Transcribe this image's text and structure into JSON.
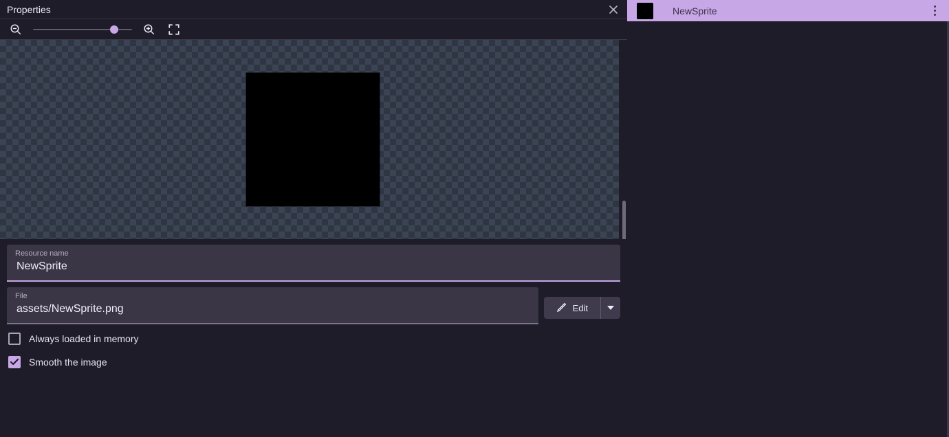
{
  "panel": {
    "title": "Properties"
  },
  "toolbar": {
    "zoom_out_icon": "zoom-out",
    "zoom_in_icon": "zoom-in",
    "fit_icon": "fit-screen",
    "slider_pct": 82
  },
  "preview": {
    "sprite_color": "#000000"
  },
  "fields": {
    "resource_label": "Resource name",
    "resource_value": "NewSprite",
    "file_label": "File",
    "file_value": "assets/NewSprite.png"
  },
  "edit": {
    "label": "Edit"
  },
  "checkboxes": {
    "always_loaded": {
      "label": "Always loaded in memory",
      "checked": false
    },
    "smooth": {
      "label": "Smooth the image",
      "checked": true
    }
  },
  "right": {
    "sprite_name": "NewSprite"
  }
}
